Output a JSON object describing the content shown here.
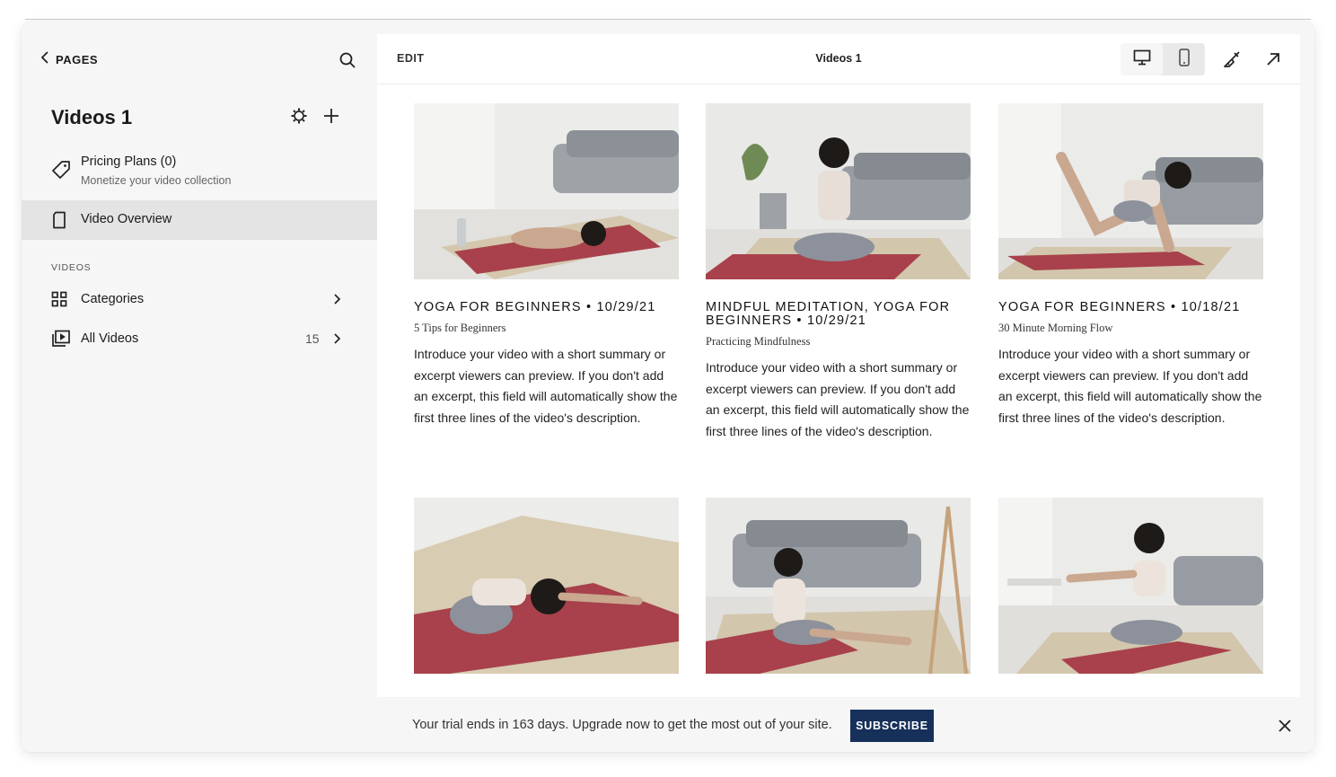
{
  "sidebar": {
    "back_label": "PAGES",
    "page_title": "Videos 1",
    "pricing": {
      "title": "Pricing Plans (0)",
      "subtitle": "Monetize your video collection"
    },
    "overview_label": "Video Overview",
    "section_label": "VIDEOS",
    "categories_label": "Categories",
    "all_videos_label": "All Videos",
    "all_videos_count": "15"
  },
  "editor": {
    "edit_label": "EDIT",
    "title": "Videos 1",
    "view_mode": "desktop"
  },
  "videos": [
    {
      "title": "YOGA FOR BEGINNERS • 10/29/21",
      "subtitle": "5 Tips for Beginners",
      "description": "Introduce your video with a short summary or excerpt viewers can preview. If you don't add an excerpt, this field will automatically show the first three lines of the video's description."
    },
    {
      "title": "MINDFUL MEDITATION, YOGA FOR BEGINNERS • 10/29/21",
      "subtitle": "Practicing Mindfulness",
      "description": "Introduce your video with a short summary or excerpt viewers can preview. If you don't add an excerpt, this field will automatically show the first three lines of the video's description."
    },
    {
      "title": "YOGA FOR BEGINNERS • 10/18/21",
      "subtitle": "30 Minute Morning Flow",
      "description": "Introduce your video with a short summary or excerpt viewers can preview. If you don't add an excerpt, this field will automatically show the first three lines of the video's description."
    }
  ],
  "banner": {
    "text": "Your trial ends in 163 days. Upgrade now to get the most out of your site.",
    "button_label": "SUBSCRIBE"
  },
  "colors": {
    "subscribe_bg": "#16305a",
    "yoga_mat": "#b0414c",
    "active_row": "#e4e4e4"
  }
}
